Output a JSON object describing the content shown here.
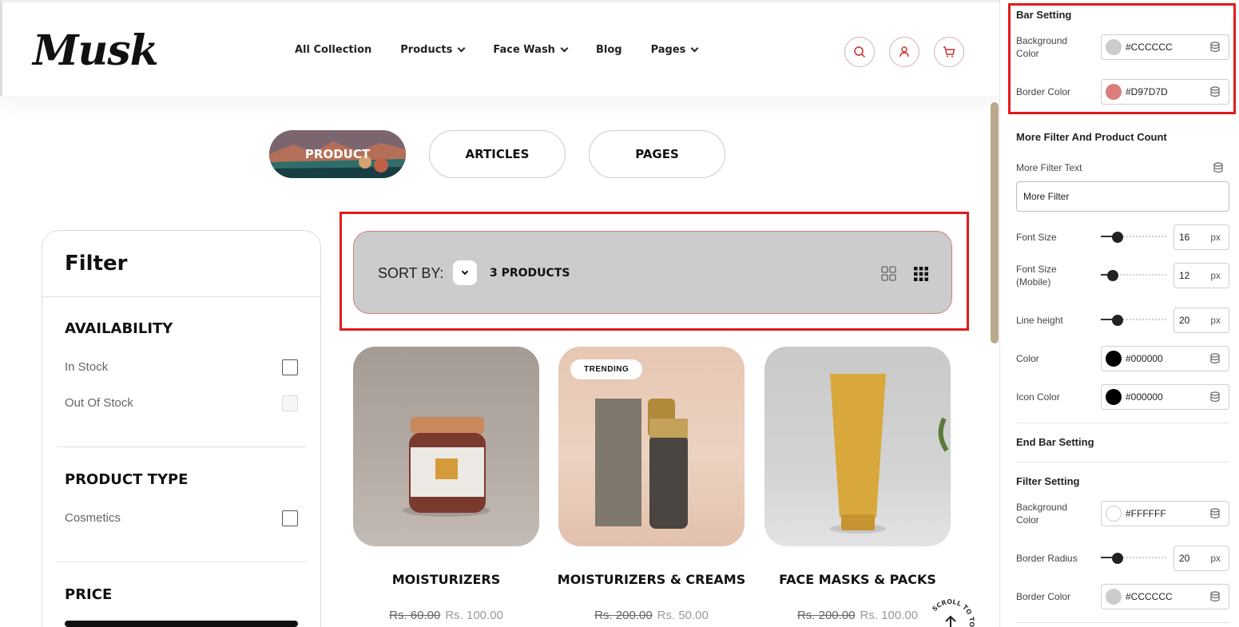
{
  "header": {
    "logo": "Musk",
    "nav": [
      "All Collection",
      "Products",
      "Face Wash",
      "Blog",
      "Pages"
    ]
  },
  "tabs": [
    "PRODUCT",
    "ARTICLES",
    "PAGES"
  ],
  "filter": {
    "title": "Filter",
    "availability": {
      "title": "AVAILABILITY",
      "options": [
        "In Stock",
        "Out Of Stock"
      ]
    },
    "product_type": {
      "title": "PRODUCT TYPE",
      "options": [
        "Cosmetics"
      ]
    },
    "price": {
      "title": "PRICE"
    }
  },
  "sortbar": {
    "label": "SORT BY:",
    "count": "3 PRODUCTS",
    "background": "#CCCCCC",
    "border": "#D97D7D"
  },
  "products": [
    {
      "title": "MOISTURIZERS",
      "old_price": "Rs. 60.00",
      "price": "Rs. 100.00",
      "badge": ""
    },
    {
      "title": "MOISTURIZERS & CREAMS",
      "old_price": "Rs. 200.00",
      "price": "Rs. 50.00",
      "badge": "TRENDING"
    },
    {
      "title": "FACE MASKS & PACKS",
      "old_price": "Rs. 200.00",
      "price": "Rs. 100.00",
      "badge": ""
    }
  ],
  "scroll_top": "SCROLL TO TOP",
  "panel": {
    "bar_setting": {
      "title": "Bar Setting",
      "bg_label": "Background Color",
      "bg_value": "#CCCCCC",
      "border_label": "Border Color",
      "border_value": "#D97D7D"
    },
    "more_filter": {
      "title": "More Filter And Product Count",
      "text_label": "More Filter Text",
      "text_value": "More Filter",
      "font_size_label": "Font Size",
      "font_size_value": "16",
      "font_size_mobile_label": "Font Size (Mobile)",
      "font_size_mobile_value": "12",
      "line_height_label": "Line height",
      "line_height_value": "20",
      "color_label": "Color",
      "color_value": "#000000",
      "icon_color_label": "Icon Color",
      "icon_color_value": "#000000",
      "unit": "px"
    },
    "end_bar_setting": "End Bar Setting",
    "filter_setting": {
      "title": "Filter Setting",
      "bg_label": "Background Color",
      "bg_value": "#FFFFFF",
      "radius_label": "Border Radius",
      "radius_value": "20",
      "border_label": "Border Color",
      "border_value": "#CCCCCC"
    }
  }
}
